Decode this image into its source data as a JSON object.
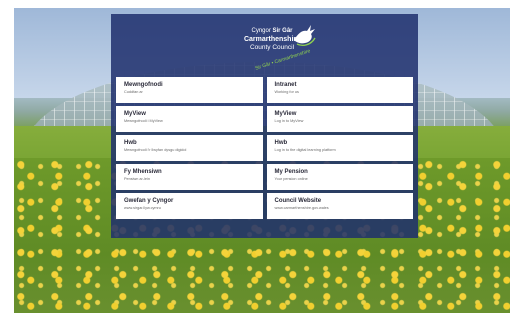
{
  "brand": {
    "cy_prefix": "Cyngor",
    "cy_bold": "Sir Gâr",
    "name": "Carmarthenshire",
    "sub": "County Council",
    "tagline": "Sir Gâr • Carmarthenshire",
    "logo_icon": "dragon-icon",
    "tagline_color": "#8fd14f"
  },
  "panel": {
    "color": "#1f306e"
  },
  "tiles": [
    {
      "title": "Mewngofnodi",
      "sub": "Cuddfan ar"
    },
    {
      "title": "Intranet",
      "sub": "Working for us"
    },
    {
      "title": "MyView",
      "sub": "Mewngofnodi i MyView"
    },
    {
      "title": "MyView",
      "sub": "Log in to MyView"
    },
    {
      "title": "Hwb",
      "sub": "Mewngofnodi i'r llwyfan dysgu digidol"
    },
    {
      "title": "Hwb",
      "sub": "Log in to the digital learning platform"
    },
    {
      "title": "Fy Mhensiwn",
      "sub": "Pensiwn ar-lein"
    },
    {
      "title": "My Pension",
      "sub": "Your pension online"
    },
    {
      "title": "Gwefan y Cyngor",
      "sub": "www.sirgar.llyw.cymru"
    },
    {
      "title": "Council Website",
      "sub": "www.carmarthenshire.gov.wales"
    }
  ]
}
